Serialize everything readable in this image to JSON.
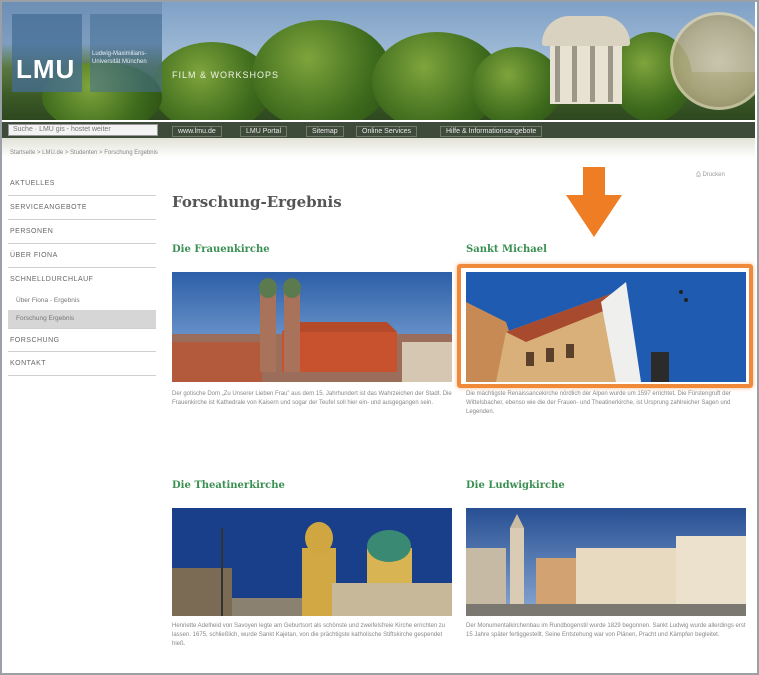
{
  "header": {
    "logo": "LMU",
    "logo_sub": "Ludwig-Maximilians-Universität München",
    "site_title": "FILM & WORKSHOPS",
    "search_placeholder": "Suche  ·  LMU gis - hostet weiter",
    "nav": [
      "www.lmu.de",
      "LMU Portal",
      "Sitemap",
      "Online Services",
      "Hilfe & Informationsangebote"
    ]
  },
  "breadcrumb": "Startseite > LMU.de > Studenten > Forschung Ergebnis",
  "sidebar": {
    "items": [
      {
        "label": "AKTUELLES"
      },
      {
        "label": "SERVICEANGEBOTE"
      },
      {
        "label": "PERSONEN"
      },
      {
        "label": "ÜBER FIONA"
      },
      {
        "label": "SCHNELLDURCHLAUF"
      }
    ],
    "subitems": [
      {
        "label": "Über Fiona - Ergebnis"
      },
      {
        "label": "Forschung Ergebnis"
      }
    ],
    "items_after": [
      {
        "label": "FORSCHUNG"
      },
      {
        "label": "KONTAKT"
      }
    ]
  },
  "print_label": "Drucken",
  "page_title": "Forschung-Ergebnis",
  "cards": [
    {
      "title": "Die Frauenkirche",
      "text": "Der gotische Dom „Zu Unserer Lieben Frau\" aus dem 15. Jahrhundert ist das Wahrzeichen der Stadt. Die Frauenkirche ist Kathedrale von Kaisern und sogar der Teufel soll hier ein- und ausgegangen sein."
    },
    {
      "title": "Sankt Michael",
      "text": "Die mächtigste Renaissancekirche nördlich der Alpen wurde um 1597 errichtet. Die Fürstengruft der Wittelsbacher, ebenso wie die der Frauen- und Theatinerkirche, ist Ursprung zahlreicher Sagen und Legenden."
    },
    {
      "title": "Die Theatinerkirche",
      "text": "Henriette Adelheid von Savoyen legte am Geburtsort als schönste und zweifelsfreie Kirche errichten zu lassen. 1675, schließlich, wurde Sankt Kajetan, von die prächtigste katholische Stiftskirche gespendet hieß."
    },
    {
      "title": "Die Ludwigkirche",
      "text": "Der Monumentalkirchenbau im Rundbogenstil wurde 1829 begonnen. Sankt Ludwig wurde allerdings erst 15 Jahre später fertiggestellt. Seine Entstehung war von Plänen, Pracht und Kämpfen begleitet."
    }
  ],
  "colors": {
    "accent_green": "#3a8f52",
    "highlight_orange": "#ef7d24"
  }
}
